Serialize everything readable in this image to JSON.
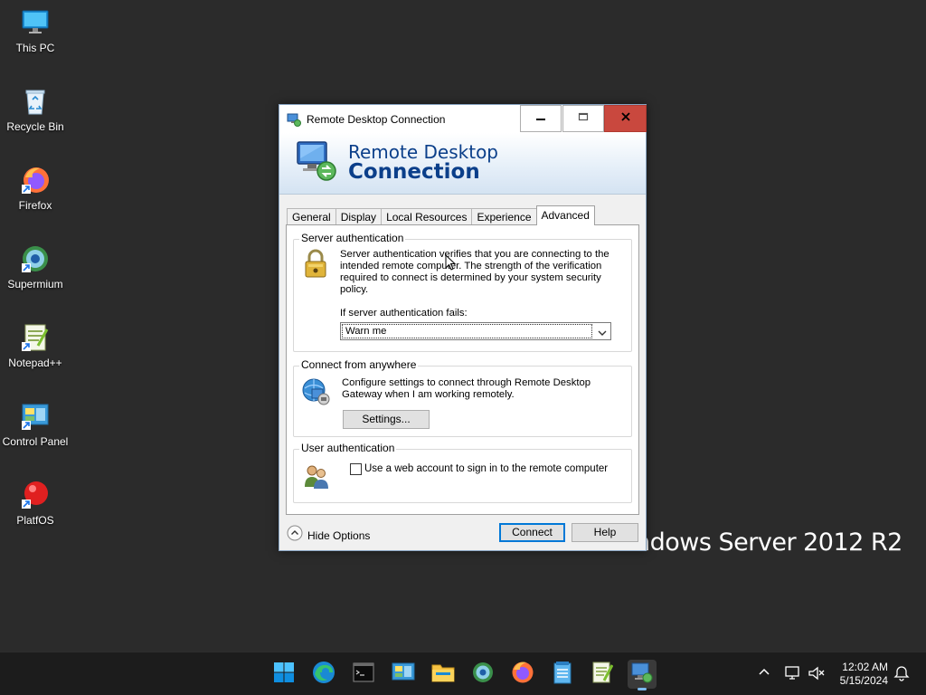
{
  "desktop": {
    "icons": [
      {
        "label": "This PC"
      },
      {
        "label": "Recycle Bin"
      },
      {
        "label": "Firefox"
      },
      {
        "label": "Supermium"
      },
      {
        "label": "Notepad++"
      },
      {
        "label": "Control Panel"
      },
      {
        "label": "PlatfOS"
      }
    ],
    "wallpaper_text": "ndows Server 2012 R2"
  },
  "window": {
    "title": "Remote Desktop Connection",
    "banner_line1": "Remote Desktop",
    "banner_line2": "Connection",
    "tabs": [
      {
        "label": "General"
      },
      {
        "label": "Display"
      },
      {
        "label": "Local Resources"
      },
      {
        "label": "Experience"
      },
      {
        "label": "Advanced",
        "active": true
      }
    ],
    "server_auth": {
      "title": "Server authentication",
      "description": "Server authentication verifies that you are connecting to the intended remote computer. The strength of the verification required to connect is determined by your system security policy.",
      "fail_label": "If server authentication fails:",
      "fail_value": "Warn me"
    },
    "connect_anywhere": {
      "title": "Connect from anywhere",
      "description": "Configure settings to connect through Remote Desktop Gateway when I am working remotely.",
      "settings_button": "Settings..."
    },
    "user_auth": {
      "title": "User authentication",
      "checkbox_label": "Use a web account to sign in to the remote computer",
      "checked": false
    },
    "footer": {
      "hide_options": "Hide Options",
      "connect_button": "Connect",
      "help_button": "Help"
    }
  },
  "taskbar": {
    "clock_time": "12:02 AM",
    "clock_date": "5/15/2024",
    "pinned": [
      "start-icon",
      "edge-icon",
      "terminal-icon",
      "control-panel-icon",
      "file-explorer-icon",
      "supermium-icon",
      "firefox-icon",
      "notepad-icon",
      "notepadpp-icon",
      "remote-desktop-icon"
    ]
  },
  "colors": {
    "accent": "#0078d7",
    "banner_text": "#0b3f8a",
    "close_button": "#c9483e",
    "desktop_bg": "#2b2b2b",
    "taskbar_bg": "#1c1c1c"
  }
}
